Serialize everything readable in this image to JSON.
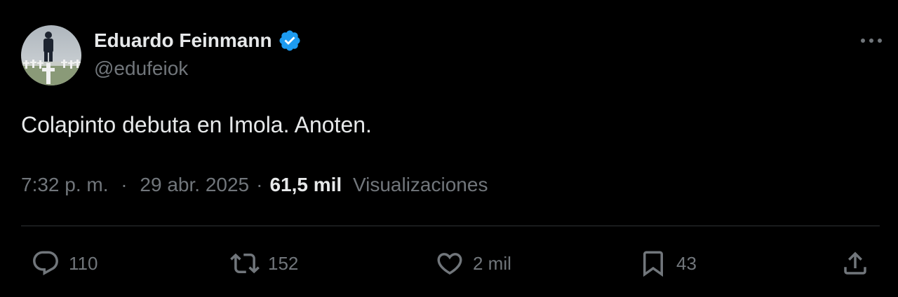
{
  "author": {
    "display_name": "Eduardo Feinmann",
    "handle": "@edufeiok",
    "verified": true,
    "verified_color": "#1d9bf0"
  },
  "tweet": {
    "text": "Colapinto debuta en Imola. Anoten.",
    "time": "7:32 p. m.",
    "separator": "·",
    "date": "29 abr. 2025",
    "views_count": "61,5 mil",
    "views_label": "Visualizaciones"
  },
  "actions": {
    "reply": {
      "icon": "reply-icon",
      "count": "110"
    },
    "repost": {
      "icon": "repost-icon",
      "count": "152"
    },
    "like": {
      "icon": "heart-icon",
      "count": "2 mil"
    },
    "bookmark": {
      "icon": "bookmark-icon",
      "count": "43"
    },
    "share": {
      "icon": "share-icon"
    }
  },
  "colors": {
    "background": "#000000",
    "text_primary": "#e7e9ea",
    "text_secondary": "#71767b",
    "divider": "#2f3336"
  }
}
